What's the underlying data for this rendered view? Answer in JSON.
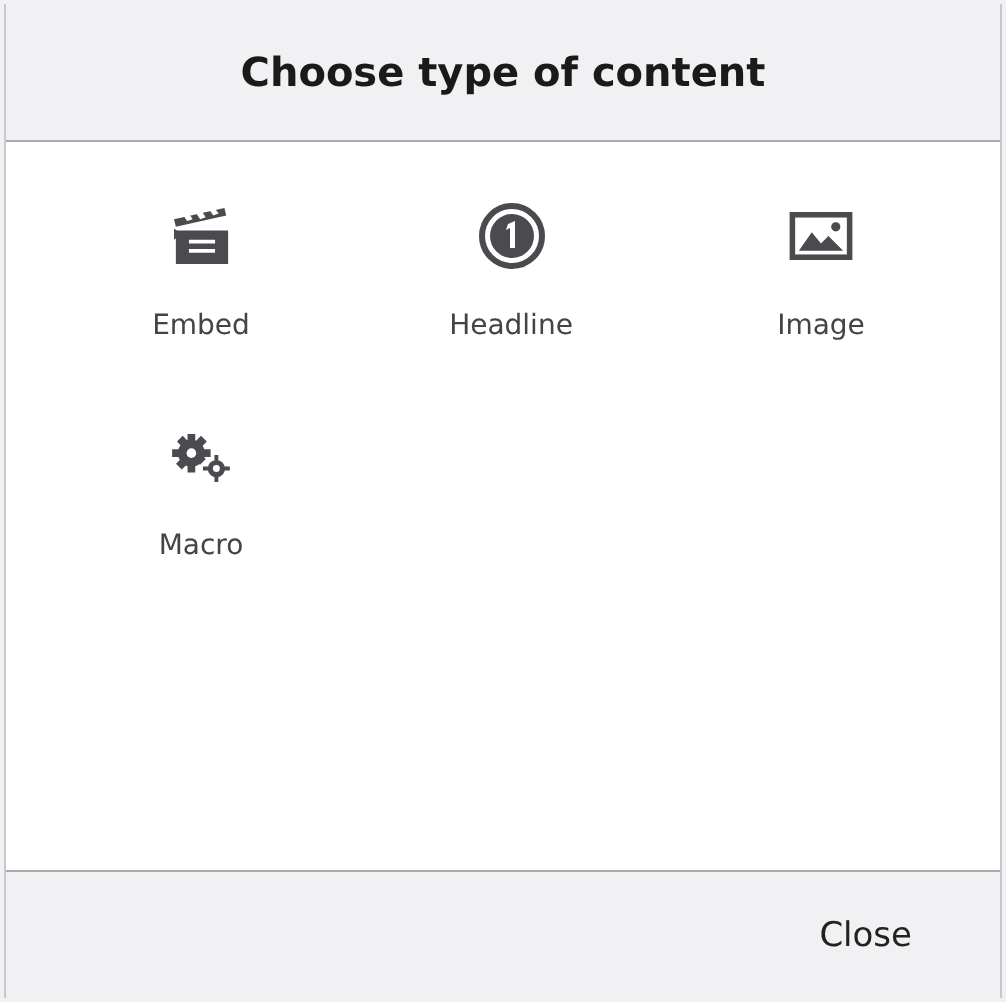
{
  "dialog": {
    "title": "Choose type of content",
    "items": [
      {
        "label": "Embed"
      },
      {
        "label": "Headline"
      },
      {
        "label": "Image"
      },
      {
        "label": "Macro"
      }
    ],
    "buttons": [
      {
        "label": "Close"
      }
    ]
  }
}
